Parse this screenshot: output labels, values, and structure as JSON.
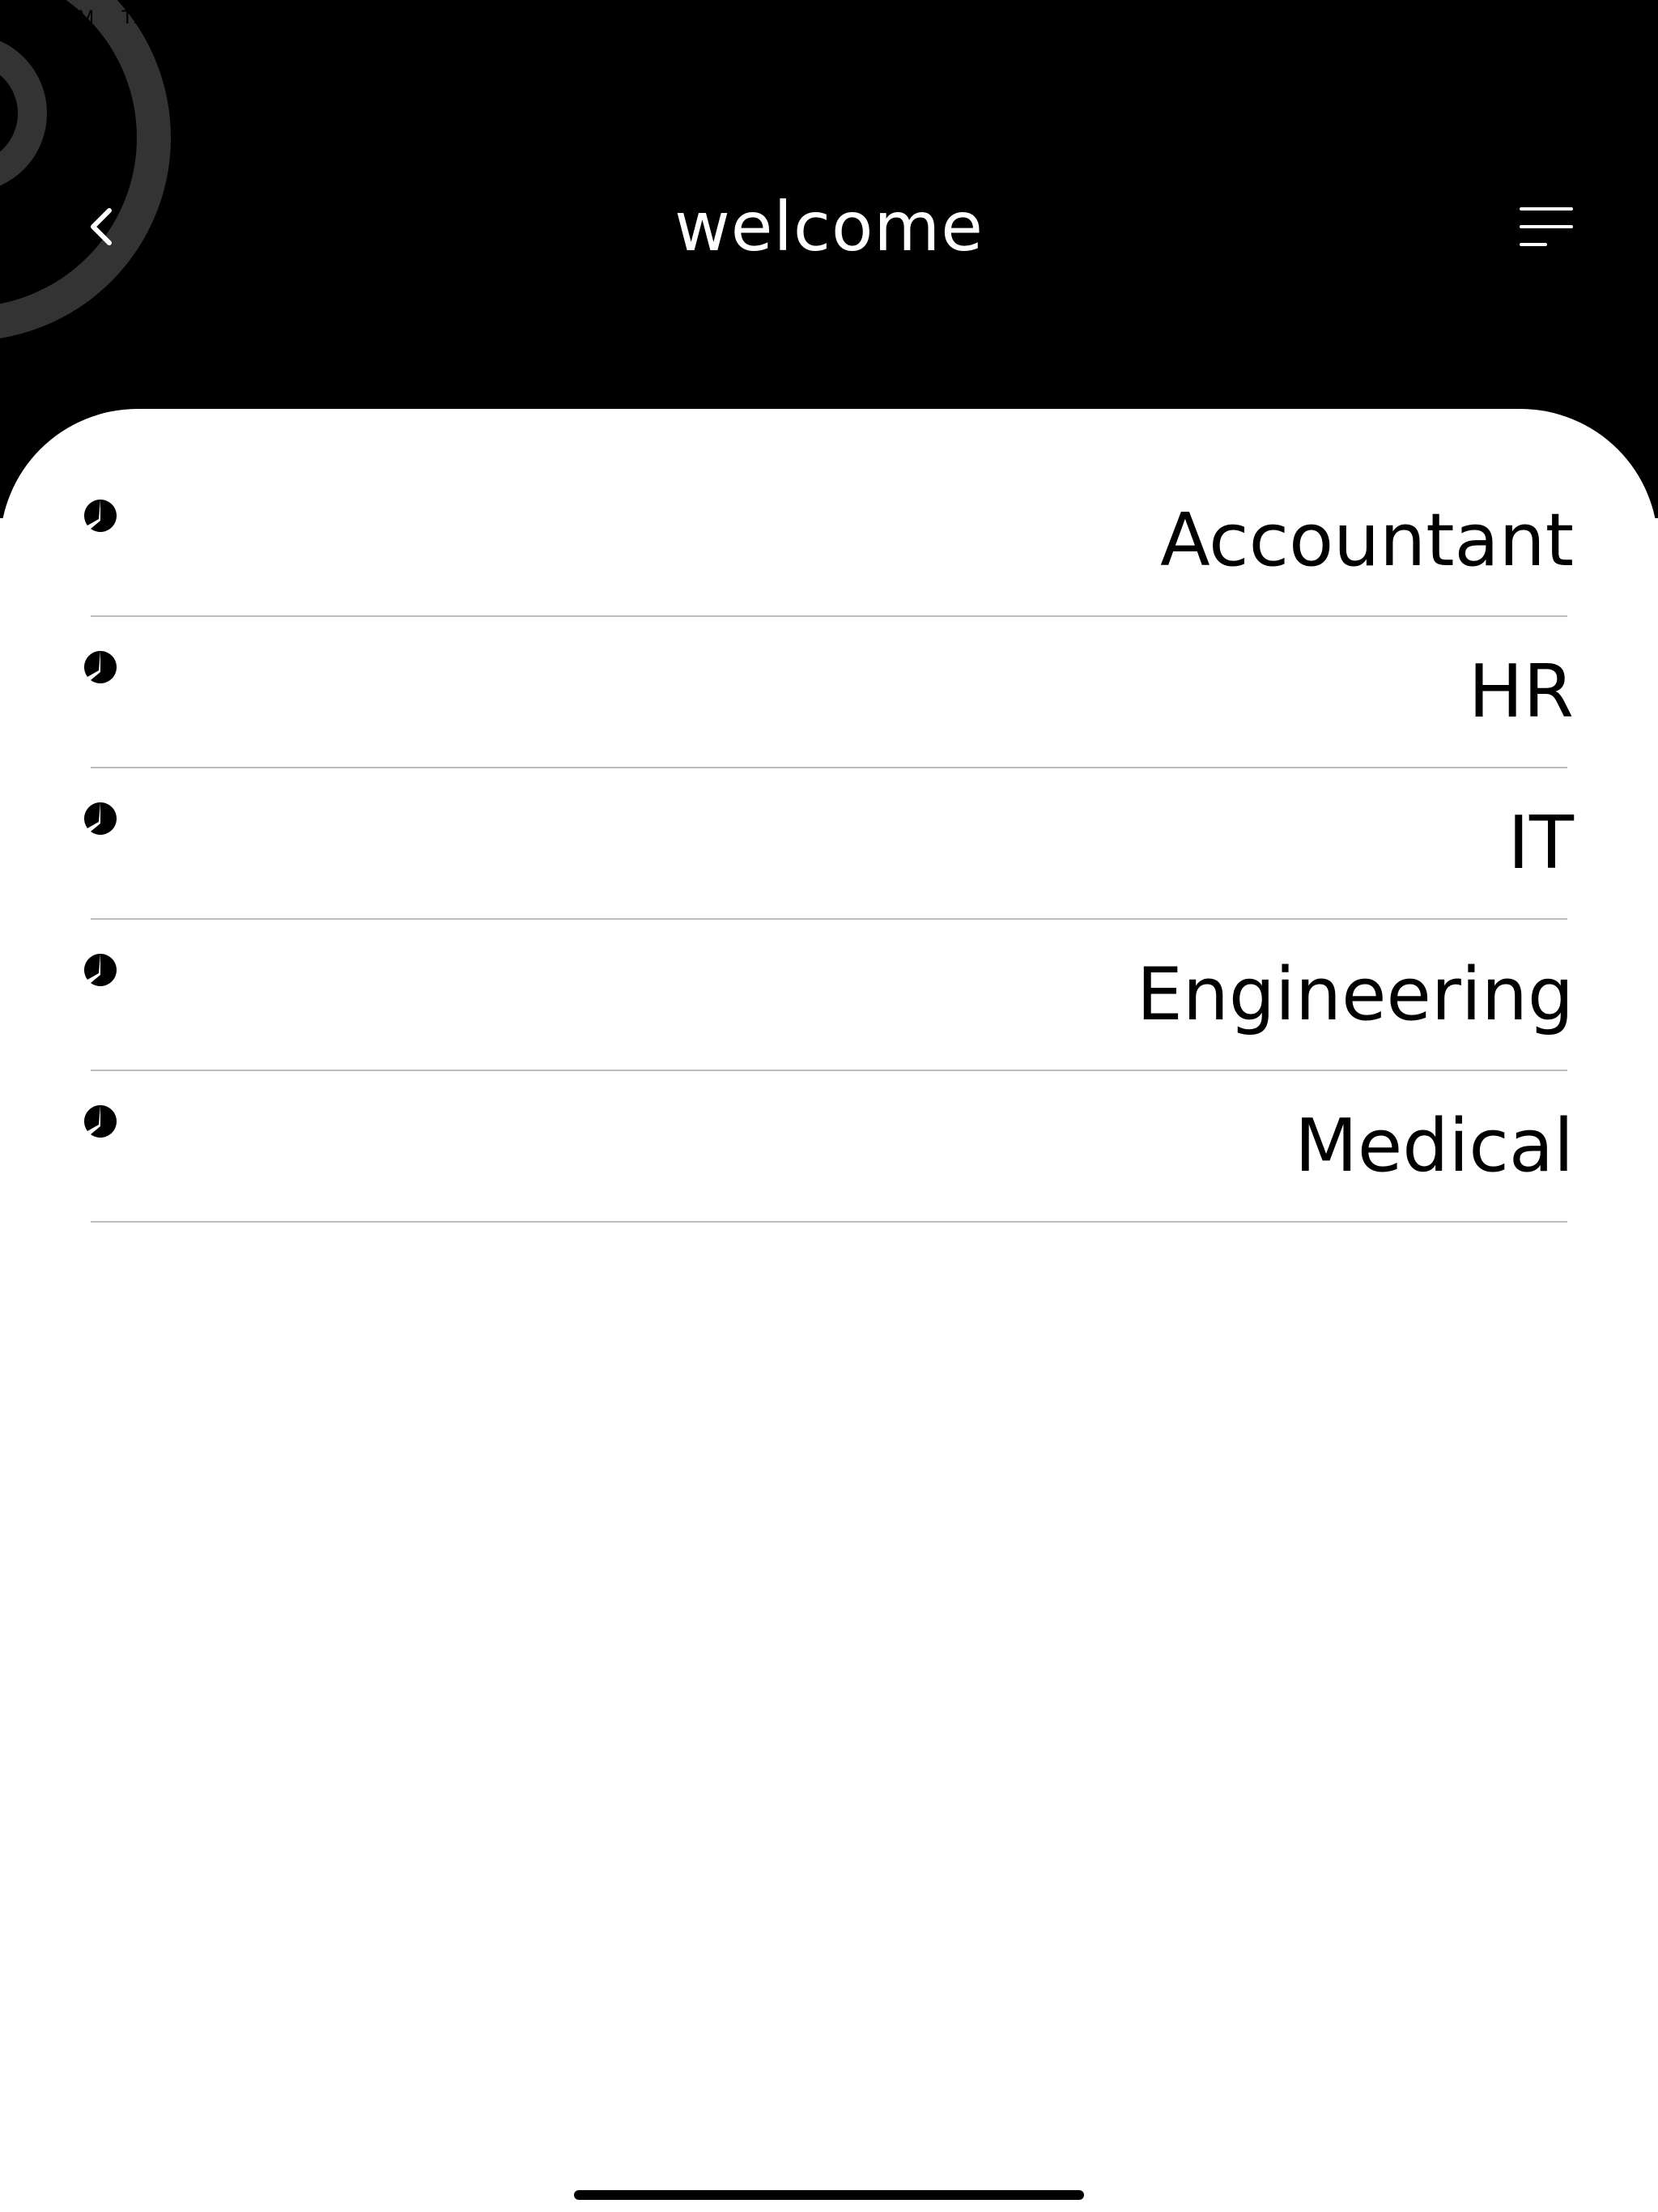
{
  "status_bar": {
    "time": "PM",
    "day": "Thu"
  },
  "header": {
    "title": "welcome",
    "back_icon": "chevron-left-icon",
    "menu_icon": "menu-icon",
    "background_color": "#000000",
    "ring_color": "#333333"
  },
  "list": {
    "items": [
      {
        "label": "Accountant"
      },
      {
        "label": "HR"
      },
      {
        "label": "IT"
      },
      {
        "label": "Engineering"
      },
      {
        "label": "Medical"
      }
    ]
  }
}
